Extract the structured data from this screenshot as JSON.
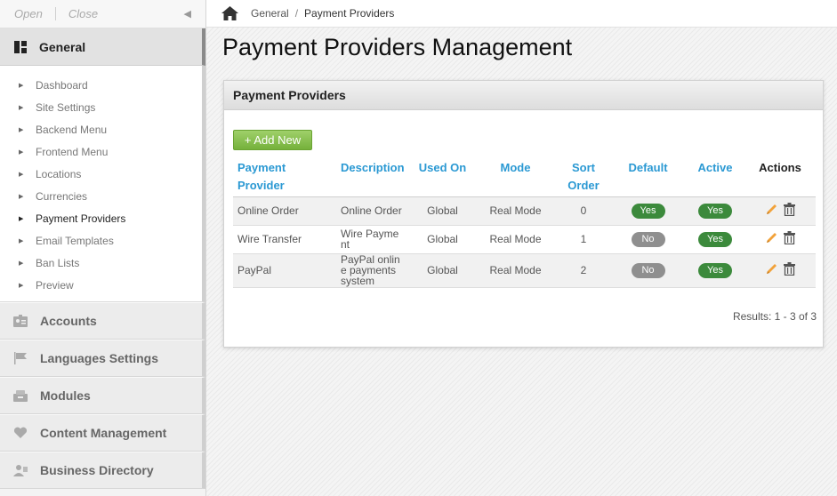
{
  "sidebar": {
    "open_label": "Open",
    "close_label": "Close",
    "section_title": "General",
    "items": [
      {
        "label": "Dashboard"
      },
      {
        "label": "Site Settings"
      },
      {
        "label": "Backend Menu"
      },
      {
        "label": "Frontend Menu"
      },
      {
        "label": "Locations"
      },
      {
        "label": "Currencies"
      },
      {
        "label": "Payment Providers"
      },
      {
        "label": "Email Templates"
      },
      {
        "label": "Ban Lists"
      },
      {
        "label": "Preview"
      }
    ],
    "groups": [
      {
        "label": "Accounts",
        "icon": "accounts-icon"
      },
      {
        "label": "Languages Settings",
        "icon": "flag-icon"
      },
      {
        "label": "Modules",
        "icon": "modules-icon"
      },
      {
        "label": "Content Management",
        "icon": "heart-icon"
      },
      {
        "label": "Business Directory",
        "icon": "directory-icon"
      }
    ]
  },
  "breadcrumb": {
    "parent": "General",
    "current": "Payment Providers"
  },
  "page": {
    "title": "Payment Providers Management"
  },
  "panel": {
    "title": "Payment Providers",
    "add_label": "+ Add New",
    "results": "Results: 1 - 3 of 3"
  },
  "table": {
    "headers": {
      "provider_1": "Payment",
      "provider_2": "Provider",
      "description": "Description",
      "used_on": "Used On",
      "mode": "Mode",
      "sort_1": "Sort",
      "sort_2": "Order",
      "default": "Default",
      "active": "Active",
      "actions": "Actions"
    },
    "rows": [
      {
        "provider": "Online Order",
        "desc_1": "Online Order",
        "desc_2": "",
        "desc_3": "",
        "used_on": "Global",
        "mode": "Real Mode",
        "sort": "0",
        "default": "Yes",
        "active": "Yes"
      },
      {
        "provider": "Wire Transfer",
        "desc_1": "Wire Payme",
        "desc_2": "nt",
        "desc_3": "",
        "used_on": "Global",
        "mode": "Real Mode",
        "sort": "1",
        "default": "No",
        "active": "Yes"
      },
      {
        "provider": "PayPal",
        "desc_1": "PayPal onlin",
        "desc_2": "e payments",
        "desc_3": "system",
        "used_on": "Global",
        "mode": "Real Mode",
        "sort": "2",
        "default": "No",
        "active": "Yes"
      }
    ]
  },
  "colors": {
    "link": "#2b99d3",
    "yes": "#3c8a3c",
    "no": "#8f8f8f",
    "add": "#86c04d"
  }
}
